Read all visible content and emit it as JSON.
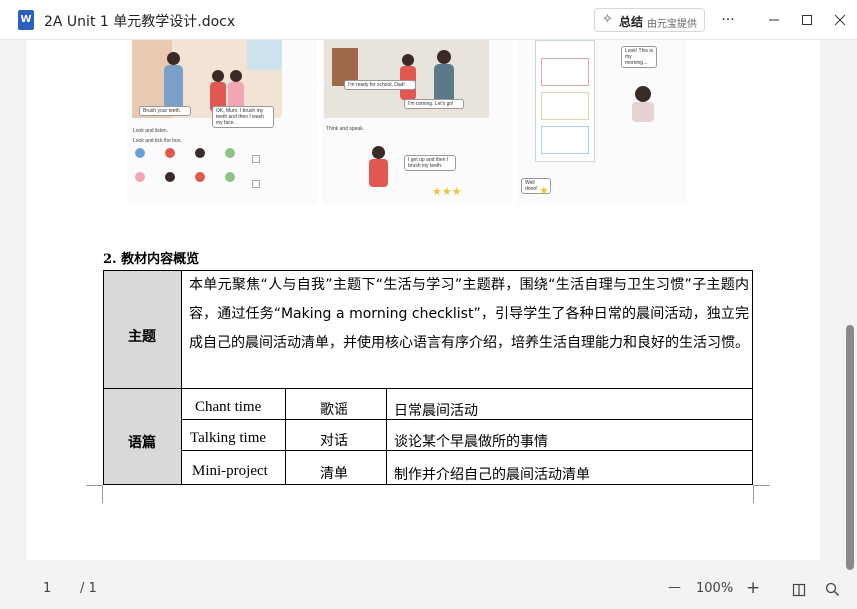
{
  "window": {
    "title": "2A Unit 1 单元教学设计.docx",
    "app_icon": "word-icon",
    "summary_button": {
      "label": "总结",
      "sub": "由元宝提供"
    },
    "more_label": "···",
    "minimize": "minimize-icon",
    "maximize": "maximize-icon",
    "close": "close-icon"
  },
  "textbook": {
    "panel1": {
      "bubble1": "Brush your teeth.",
      "bubble2": "OK, Mum. I brush my teeth and then I wash my face.",
      "line1": "Look and listen.",
      "line2": "Look and tick the box."
    },
    "panel2": {
      "bubble1": "I'm ready for school, Dad!",
      "bubble2": "I'm coming. Let's go!",
      "line1": "Think and speak.",
      "bubble3": "I get up and then I brush my teeth."
    },
    "panel3": {
      "bubble1": "Look! This is my morning...",
      "done": "Well done!"
    }
  },
  "document": {
    "section_heading": "2.  教材内容概览",
    "table": {
      "topic_header": "主题",
      "topic_text": "本单元聚焦“人与自我”主题下“生活与学习”主题群，围绕“生活自理与卫生习惯”子主题内容，通过任务“Making a morning checklist”，引导学生了各种日常的晨间活动，独立完成自己的晨间活动清单，并使用核心语言有序介绍，培养生活自理能力和良好的生活习惯。",
      "texts_header": "语篇",
      "rows": [
        {
          "name": "Chant time",
          "type": "歌谣",
          "desc": "日常晨间活动"
        },
        {
          "name": "Talking time",
          "type": "对话",
          "desc": "谈论某个早晨做所的事情"
        },
        {
          "name": "Mini-project",
          "type": "清单",
          "desc": "制作并介绍自己的晨间活动清单"
        }
      ]
    }
  },
  "statusbar": {
    "page_current": "1",
    "page_total": "/ 1",
    "zoom_out": "—",
    "zoom": "100%",
    "zoom_in": "+",
    "layout_icon": "columns-icon",
    "search_icon": "search-icon"
  }
}
